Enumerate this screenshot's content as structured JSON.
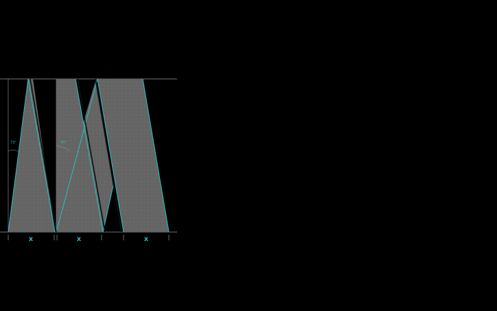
{
  "diagram": {
    "angle_labels": [
      "73°",
      "30°"
    ],
    "width_labels": [
      "x",
      "x",
      "x"
    ],
    "colors": {
      "background": "#000000",
      "fill": "#6a6a6a",
      "edge": "#2bb8b8",
      "guide": "#9a9a9a",
      "dark_stroke": "#101010"
    }
  }
}
